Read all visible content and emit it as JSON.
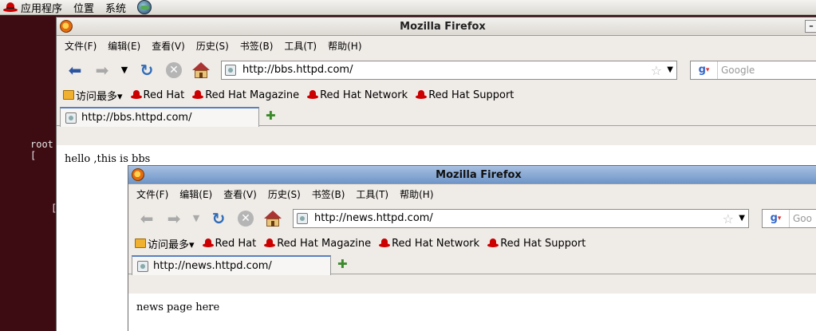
{
  "panel": {
    "applications": "应用程序",
    "places": "位置",
    "system": "系统"
  },
  "terminal": {
    "prompt": "root [",
    "bracket": "["
  },
  "windows": [
    {
      "title": "Mozilla Firefox",
      "menu": [
        "文件(F)",
        "编辑(E)",
        "查看(V)",
        "历史(S)",
        "书签(B)",
        "工具(T)",
        "帮助(H)"
      ],
      "url": "http://bbs.httpd.com/",
      "search_placeholder": "Google",
      "bookmarks": [
        "访问最多▾",
        "Red Hat",
        "Red Hat Magazine",
        "Red Hat Network",
        "Red Hat Support"
      ],
      "tab_title": "http://bbs.httpd.com/",
      "content": "hello ,this is bbs",
      "minimize_label": "–"
    },
    {
      "title": "Mozilla Firefox",
      "menu": [
        "文件(F)",
        "编辑(E)",
        "查看(V)",
        "历史(S)",
        "书签(B)",
        "工具(T)",
        "帮助(H)"
      ],
      "url": "http://news.httpd.com/",
      "search_placeholder": "Goo",
      "bookmarks": [
        "访问最多▾",
        "Red Hat",
        "Red Hat Magazine",
        "Red Hat Network",
        "Red Hat Support"
      ],
      "tab_title": "http://news.httpd.com/",
      "content": "news page here"
    }
  ]
}
